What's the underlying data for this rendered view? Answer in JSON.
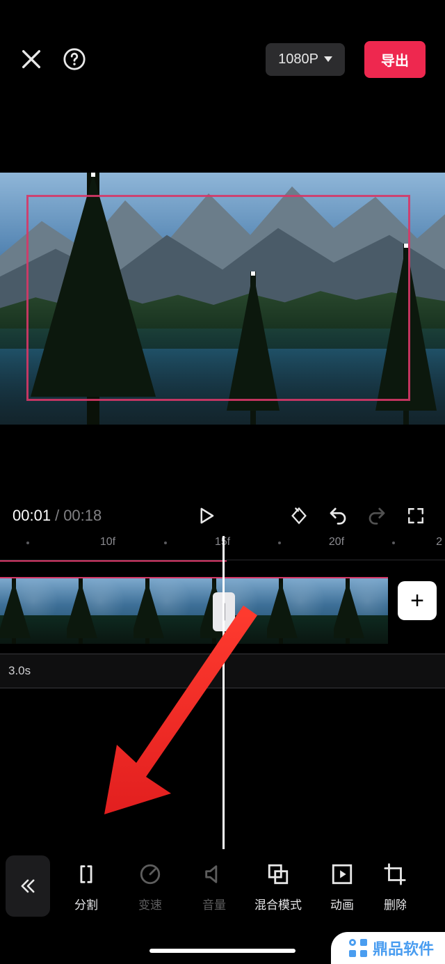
{
  "header": {
    "resolution": "1080P",
    "export_label": "导出"
  },
  "transport": {
    "current_time": "00:01",
    "duration": "00:18"
  },
  "timeline": {
    "ruler_ticks": [
      "10f",
      "15f",
      "20f"
    ],
    "ruler_cut_number": "2",
    "track2_label": "3.0s"
  },
  "toolbar": {
    "items": [
      {
        "id": "split",
        "label": "分割",
        "disabled": false
      },
      {
        "id": "speed",
        "label": "变速",
        "disabled": true
      },
      {
        "id": "volume",
        "label": "音量",
        "disabled": true
      },
      {
        "id": "blend",
        "label": "混合模式",
        "disabled": false
      },
      {
        "id": "anim",
        "label": "动画",
        "disabled": false
      },
      {
        "id": "delete",
        "label": "删除",
        "disabled": false
      }
    ]
  },
  "watermark": {
    "text": "鼎品软件"
  }
}
